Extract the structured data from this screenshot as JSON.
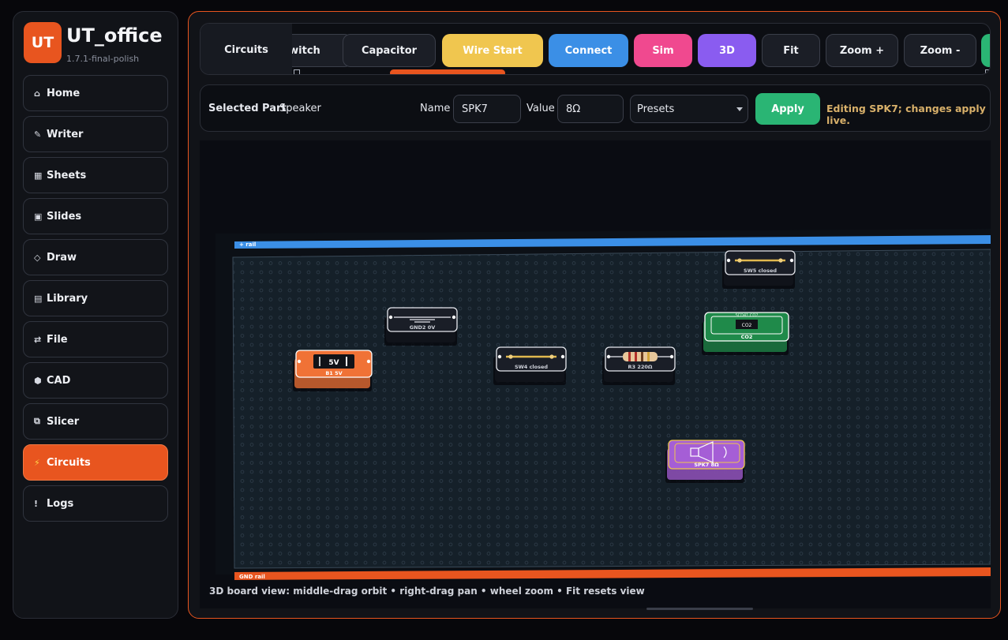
{
  "app": {
    "logo": "UT",
    "name": "UT_office",
    "version": "1.7.1-final-polish"
  },
  "sidebar": {
    "items": [
      {
        "icon": "⌂",
        "icon_name": "home-icon",
        "label": "Home"
      },
      {
        "icon": "✎",
        "icon_name": "pencil-icon",
        "label": "Writer"
      },
      {
        "icon": "▦",
        "icon_name": "grid-icon",
        "label": "Sheets"
      },
      {
        "icon": "▣",
        "icon_name": "slides-icon",
        "label": "Slides"
      },
      {
        "icon": "◇",
        "icon_name": "diamond-icon",
        "label": "Draw"
      },
      {
        "icon": "▤",
        "icon_name": "library-icon",
        "label": "Library"
      },
      {
        "icon": "⇄",
        "icon_name": "swap-icon",
        "label": "File"
      },
      {
        "icon": "⬢",
        "icon_name": "hexagon-icon",
        "label": "CAD"
      },
      {
        "icon": "⧉",
        "icon_name": "layers-icon",
        "label": "Slicer"
      },
      {
        "icon": "⚡",
        "icon_name": "lightning-icon",
        "label": "Circuits",
        "active": true
      },
      {
        "icon": "!",
        "icon_name": "alert-icon",
        "label": "Logs"
      }
    ]
  },
  "toolbar": {
    "label": "Circuits",
    "buttons": [
      {
        "label": "Switch",
        "visible_text": "witch",
        "style": "dark"
      },
      {
        "label": "Capacitor",
        "style": "dark"
      },
      {
        "label": "Wire Start",
        "style": "filled",
        "color": "#f0c64f",
        "text_color": "#ffffff"
      },
      {
        "label": "Connect",
        "style": "filled",
        "color": "#3b8fe6",
        "text_color": "#ffffff"
      },
      {
        "label": "Sim",
        "style": "filled",
        "color": "#f0498f",
        "text_color": "#ffffff"
      },
      {
        "label": "3D",
        "style": "filled",
        "color": "#8a5cf0",
        "text_color": "#ffffff"
      },
      {
        "label": "Fit",
        "style": "dark"
      },
      {
        "label": "Zoom +",
        "style": "dark"
      },
      {
        "label": "Zoom -",
        "style": "dark"
      },
      {
        "label": "",
        "style": "filled",
        "color": "#2ab574",
        "text_color": "#ffffff"
      }
    ]
  },
  "properties": {
    "selected_label": "Selected Part",
    "selected_value": "Speaker",
    "name_label": "Name",
    "name_value": "SPK7",
    "value_label": "Value",
    "value_value": "8Ω",
    "presets_label": "Presets",
    "apply_label": "Apply",
    "status": "Editing SPK7; changes apply live."
  },
  "board": {
    "plus_rail_label": "+ rail",
    "gnd_rail_label": "GND rail",
    "colors": {
      "plus_rail": "#3b8fe6",
      "gnd_rail": "#e8551f",
      "board": "#152029"
    },
    "parts": [
      {
        "id": "B1",
        "kind": "battery",
        "symbol": "5V",
        "label": "B1 5V",
        "color": "#f07236"
      },
      {
        "id": "GND2",
        "kind": "ground",
        "label": "GND2 0V",
        "color": "#1a1e27"
      },
      {
        "id": "SW4",
        "kind": "switch",
        "label": "SW4 closed",
        "color": "#1a1e27"
      },
      {
        "id": "R3",
        "kind": "resistor",
        "label": "R3 220Ω",
        "color": "#1a1e27"
      },
      {
        "id": "SW5",
        "kind": "switch",
        "label": "SW5 closed",
        "color": "#1a1e27"
      },
      {
        "id": "CO2",
        "kind": "sensor",
        "top_text": "SCD41 CO2",
        "symbol": "CO2",
        "label": "CO2",
        "color": "#1f8a4a"
      },
      {
        "id": "SPK7",
        "kind": "speaker",
        "label": "SPK7 8Ω",
        "color": "#a55ed6",
        "selected": true
      }
    ]
  },
  "hint": "3D board view: middle-drag orbit • right-drag pan • wheel zoom • Fit resets view"
}
